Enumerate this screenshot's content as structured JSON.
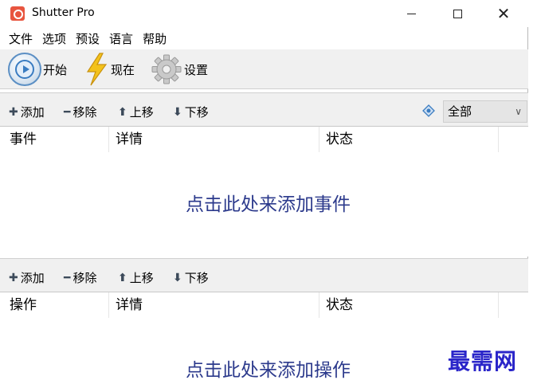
{
  "window": {
    "title": "Shutter Pro",
    "controls": {
      "minimize": "–",
      "maximize": "□",
      "close": "✕"
    }
  },
  "menu": [
    "文件",
    "选项",
    "预设",
    "语言",
    "帮助"
  ],
  "toolbar": {
    "start_label": "开始",
    "now_label": "现在",
    "settings_label": "设置",
    "icons": {
      "start": "play-circle-icon",
      "now": "lightning-bolt-icon",
      "settings": "gear-icon"
    }
  },
  "events_toolbar": {
    "add": "添加",
    "remove": "移除",
    "move_up": "上移",
    "move_down": "下移",
    "filter_selected": "全部"
  },
  "events_list": {
    "columns": [
      "事件",
      "详情",
      "状态"
    ],
    "empty_message": "点击此处来添加事件"
  },
  "actions_toolbar": {
    "add": "添加",
    "remove": "移除",
    "move_up": "上移",
    "move_down": "下移"
  },
  "actions_list": {
    "columns": [
      "操作",
      "详情",
      "状态"
    ],
    "empty_message": "点击此处来添加操作"
  },
  "watermark": "最需网",
  "colors": {
    "accent_blue": "#3a7cc1",
    "bolt_yellow": "#f3c21b",
    "empty_text": "#2c3a8c",
    "watermark": "#2a25c9",
    "app_icon": "#e8553f"
  }
}
